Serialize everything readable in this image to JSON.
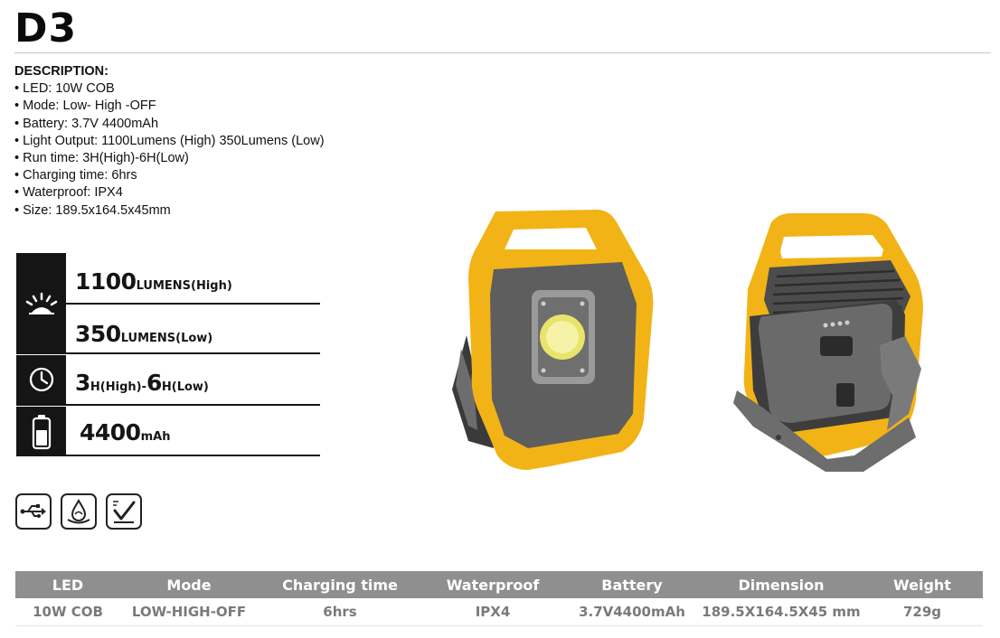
{
  "model": "D3",
  "description": {
    "heading": "DESCRIPTION:",
    "items": [
      "LED: 10W COB",
      "Mode: Low- High -OFF",
      "Battery: 3.7V 4400mAh",
      "Light Output: 1100Lumens (High) 350Lumens (Low)",
      "Run time: 3H(High)-6H(Low)",
      "Charging time: 6hrs",
      "Waterproof: IPX4",
      "Size: 189.5x164.5x45mm"
    ]
  },
  "spec_panel": {
    "lumens_high": {
      "number": "1100",
      "unit": "LUMENS(High)"
    },
    "lumens_low": {
      "number": "350",
      "unit": "LUMENS(Low)"
    },
    "runtime": {
      "high_number": "3",
      "high_unit": "H(High)-",
      "low_number": "6",
      "low_unit": "H(Low)"
    },
    "battery": {
      "number": "4400",
      "unit": "mAh"
    }
  },
  "feature_icons": [
    "usb-icon",
    "waterproof-icon",
    "switch-icon"
  ],
  "table": {
    "headers": [
      "LED",
      "Mode",
      "Charging time",
      "Waterproof",
      "Battery",
      "Dimension",
      "Weight"
    ],
    "rows": [
      [
        "10W COB",
        "LOW-HIGH-OFF",
        "6hrs",
        "IPX4",
        "3.7V4400mAh",
        "189.5X164.5X45 mm",
        "729g"
      ]
    ]
  },
  "colors": {
    "housing": "#f2b317",
    "panel": "#5e5e5e",
    "header_bg": "#8f8f8f"
  }
}
